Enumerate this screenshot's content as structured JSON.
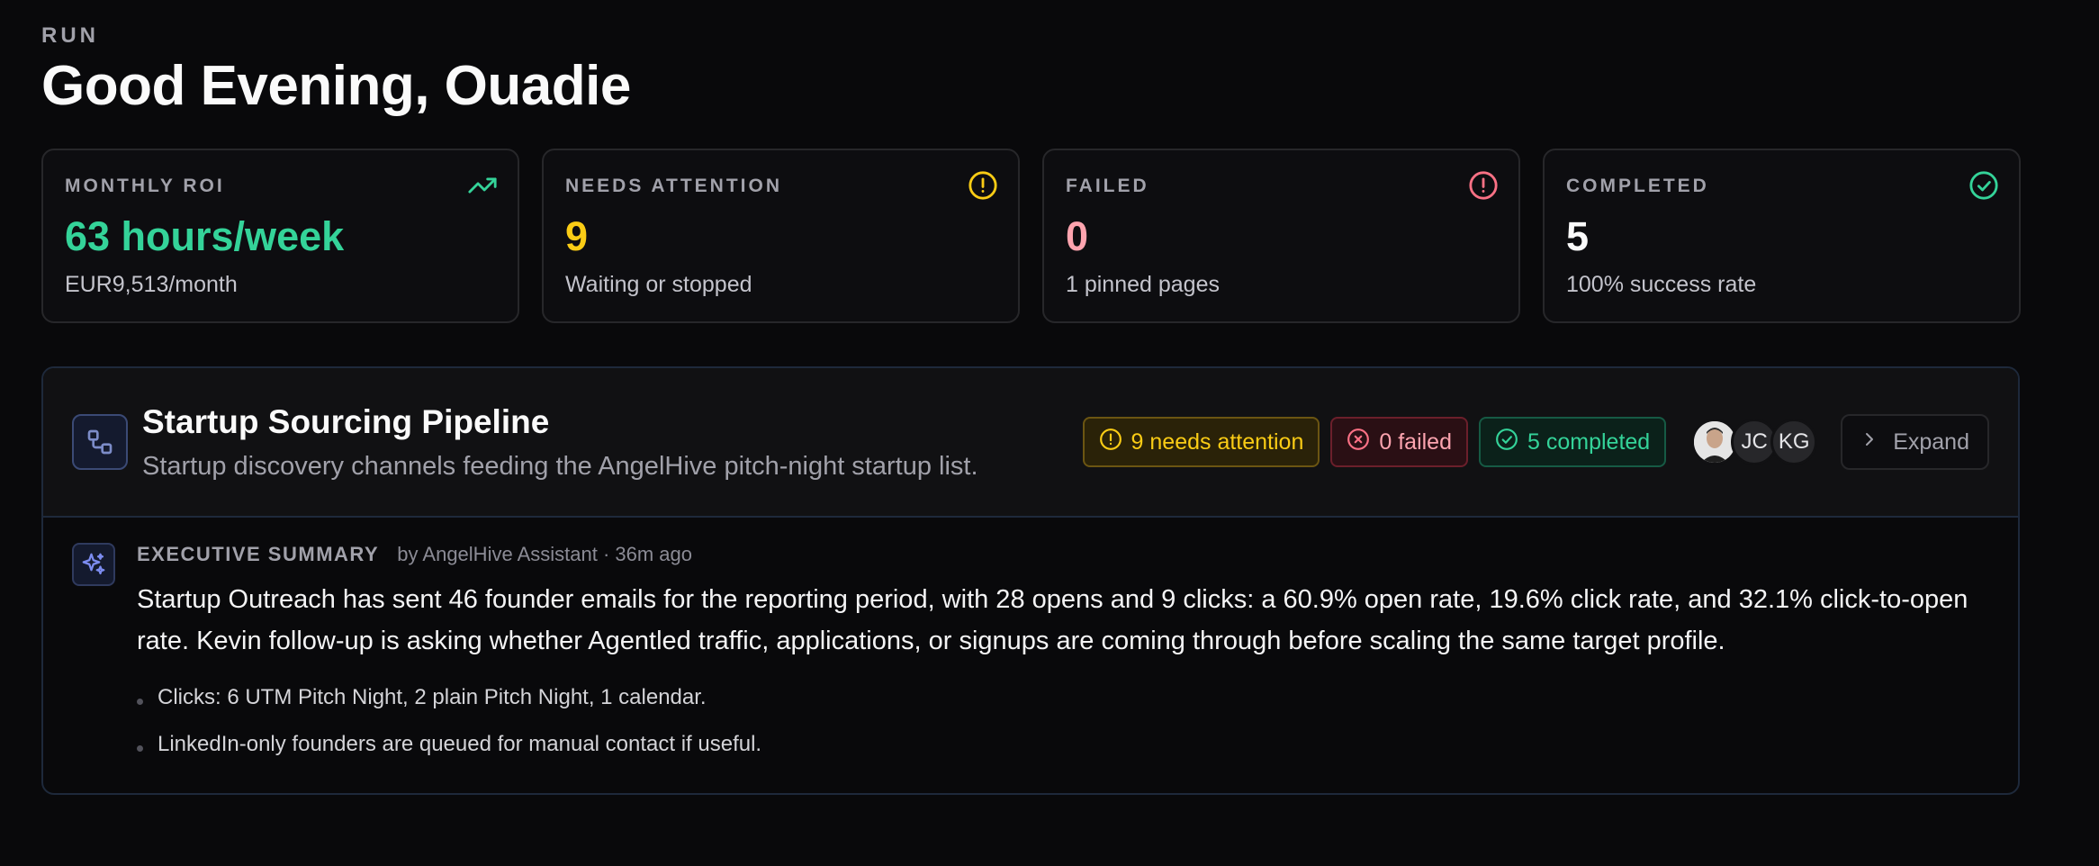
{
  "header": {
    "eyebrow": "RUN",
    "greeting": "Good Evening, Ouadie"
  },
  "stats": [
    {
      "label": "MONTHLY ROI",
      "value": "63 hours/week",
      "sub": "EUR9,513/month",
      "icon": "trending-up-icon",
      "color": "#34d399"
    },
    {
      "label": "NEEDS ATTENTION",
      "value": "9",
      "sub": "Waiting or stopped",
      "icon": "alert-circle-icon",
      "color": "#facc15"
    },
    {
      "label": "FAILED",
      "value": "0",
      "sub": "1 pinned pages",
      "icon": "alert-circle-icon",
      "color": "#fda4af"
    },
    {
      "label": "COMPLETED",
      "value": "5",
      "sub": "100% success rate",
      "icon": "check-circle-icon",
      "color": "#34d399"
    }
  ],
  "pipeline": {
    "title": "Startup Sourcing Pipeline",
    "description": "Startup discovery channels feeding the AngelHive pitch-night startup list.",
    "badges": {
      "attention": "9 needs attention",
      "failed": "0 failed",
      "completed": "5 completed"
    },
    "avatars": [
      "JC",
      "KG"
    ],
    "expand_label": "Expand",
    "summary": {
      "label": "EXECUTIVE SUMMARY",
      "meta": "by AngelHive Assistant · 36m ago",
      "text": "Startup Outreach has sent 46 founder emails for the reporting period, with 28 opens and 9 clicks: a 60.9% open rate, 19.6% click rate, and 32.1% click-to-open rate. Kevin follow-up is asking whether Agentled traffic, applications, or signups are coming through before scaling the same target profile.",
      "bullets": [
        "Clicks: 6 UTM Pitch Night, 2 plain Pitch Night, 1 calendar.",
        "LinkedIn-only founders are queued for manual contact if useful."
      ]
    }
  }
}
